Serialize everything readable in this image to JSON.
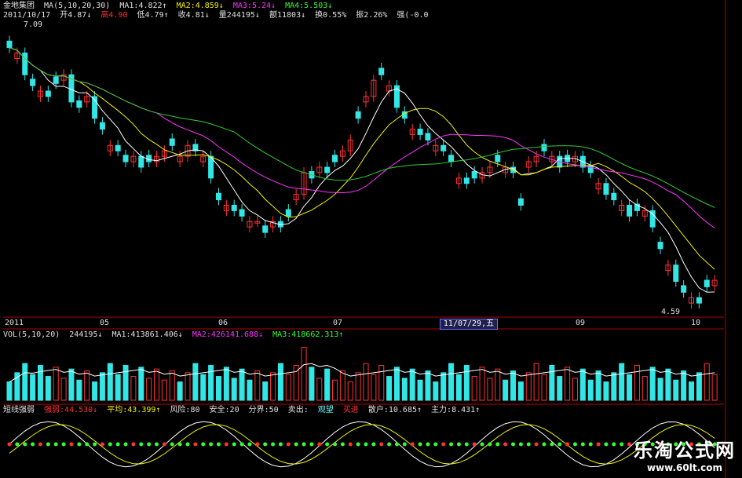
{
  "header": {
    "stock_name": "金地集团",
    "ma_def": "MA(5,10,20,30)",
    "ma1": "MA1:4.822↑",
    "ma2": "MA2:4.859↓",
    "ma3": "MA3:5.24↓",
    "ma4": "MA4:5.503↓",
    "date": "2011/10/17",
    "open": "开4.87↓",
    "high": "高4.90",
    "low": "低4.79↑",
    "close": "收4.81↓",
    "volume": "量244195↓",
    "amount": "额11803↓",
    "turnover": "换0.55%",
    "amplitude": "振2.26%",
    "strength": "强(-0.0"
  },
  "price_annotations": {
    "high": "7.09",
    "low": "4.59"
  },
  "time_axis": {
    "labels": [
      "2011",
      "05",
      "06",
      "07",
      "09",
      "10"
    ],
    "cursor_date": "11/07/29,五"
  },
  "vol_header": {
    "def": "VOL(5,10,20)",
    "vol": "244195↓",
    "ma1": "MA1:413861.406↓",
    "ma2": "MA2:426141.688↓",
    "ma3": "MA3:418662.313↑"
  },
  "ind_header": {
    "name": "短线强弱",
    "strong": "强弱:44.530↓",
    "avg": "平均:43.399↑",
    "risk": "风险:80",
    "safe": "安全:20",
    "divide": "分界:50",
    "sell": "卖出:",
    "watch": "观望",
    "buy": "买进",
    "retail": "散户:10.685↑",
    "main": "主力:8.431↑"
  },
  "watermark": {
    "title": "乐淘公式网",
    "url": "www.60lt.com"
  },
  "colors": {
    "up": "#ff3333",
    "down": "#33e6e6",
    "ma5": "#ffffff",
    "ma10": "#f4f100",
    "ma20": "#ff33ff",
    "ma30": "#33cc33"
  },
  "chart_data": {
    "type": "candlestick",
    "price_closes": [
      6.95,
      6.9,
      6.7,
      6.6,
      6.55,
      6.5,
      6.62,
      6.7,
      6.45,
      6.4,
      6.5,
      6.3,
      6.2,
      6.05,
      6.0,
      5.9,
      5.95,
      5.85,
      5.9,
      5.95,
      6.0,
      6.05,
      5.95,
      6.05,
      6.0,
      5.95,
      5.75,
      5.55,
      5.5,
      5.45,
      5.4,
      5.35,
      5.35,
      5.25,
      5.35,
      5.3,
      5.4,
      5.6,
      5.8,
      5.75,
      5.85,
      5.8,
      5.9,
      6.0,
      6.1,
      6.3,
      6.5,
      6.65,
      6.7,
      6.6,
      6.4,
      6.3,
      6.2,
      6.15,
      6.1,
      6.05,
      6.0,
      5.9,
      5.75,
      5.7,
      5.75,
      5.8,
      5.85,
      5.9,
      5.85,
      5.8,
      5.5,
      5.9,
      5.95,
      6.0,
      5.95,
      5.85,
      5.9,
      5.95,
      5.85,
      5.8,
      5.7,
      5.6,
      5.55,
      5.5,
      5.4,
      5.45,
      5.45,
      5.3,
      5.1,
      4.95,
      4.8,
      4.7,
      4.65,
      4.6,
      4.75,
      4.81
    ],
    "price_ylim": [
      4.5,
      7.2
    ],
    "vol_ylim": [
      0,
      1200000
    ]
  }
}
